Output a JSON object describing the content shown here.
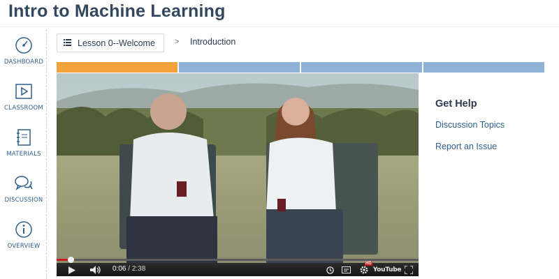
{
  "course": {
    "title": "Intro to Machine Learning"
  },
  "sidebar": {
    "items": [
      {
        "label": "DASHBOARD",
        "icon": "dashboard-gauge-icon"
      },
      {
        "label": "CLASSROOM",
        "icon": "play-video-icon"
      },
      {
        "label": "MATERIALS",
        "icon": "notebook-icon"
      },
      {
        "label": "DISCUSSION",
        "icon": "speech-bubbles-icon"
      },
      {
        "label": "OVERVIEW",
        "icon": "info-icon"
      }
    ]
  },
  "breadcrumb": {
    "lesson_label": "Lesson 0--Welcome",
    "separator": ">",
    "current": "Introduction"
  },
  "progress": {
    "segments": [
      {
        "state": "active",
        "color": "#f2a23a"
      },
      {
        "state": "inactive",
        "color": "#8fb3d6"
      },
      {
        "state": "inactive",
        "color": "#8fb3d6"
      },
      {
        "state": "inactive",
        "color": "#8fb3d6"
      }
    ]
  },
  "video": {
    "current_time": "0:06",
    "separator": " / ",
    "duration": "2:38",
    "played_fraction": 0.038,
    "hd_badge": "HD",
    "brand": "YouTube",
    "accent": "#cc181e"
  },
  "help": {
    "title": "Get Help",
    "links": [
      "Discussion Topics",
      "Report an Issue"
    ]
  }
}
